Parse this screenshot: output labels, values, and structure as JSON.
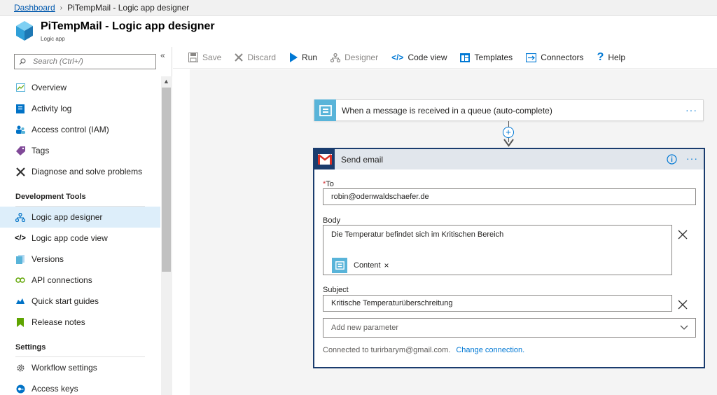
{
  "breadcrumb": {
    "home": "Dashboard",
    "separator": "›",
    "current": "PiTempMail - Logic app designer"
  },
  "header": {
    "title": "PiTempMail - Logic app designer",
    "subtitle": "Logic app"
  },
  "sidebar": {
    "search_placeholder": "Search (Ctrl+/)",
    "collapse": "«",
    "items": [
      {
        "label": "Overview",
        "icon": "overview-icon"
      },
      {
        "label": "Activity log",
        "icon": "activity-log-icon"
      },
      {
        "label": "Access control (IAM)",
        "icon": "iam-icon"
      },
      {
        "label": "Tags",
        "icon": "tag-icon"
      },
      {
        "label": "Diagnose and solve problems",
        "icon": "wrench-icon"
      }
    ],
    "dev_section": "Development Tools",
    "dev_items": [
      {
        "label": "Logic app designer",
        "icon": "designer-icon",
        "active": true
      },
      {
        "label": "Logic app code view",
        "icon": "code-icon"
      },
      {
        "label": "Versions",
        "icon": "versions-icon"
      },
      {
        "label": "API connections",
        "icon": "api-connections-icon"
      },
      {
        "label": "Quick start guides",
        "icon": "quickstart-icon"
      },
      {
        "label": "Release notes",
        "icon": "release-notes-icon"
      }
    ],
    "settings_section": "Settings",
    "settings_items": [
      {
        "label": "Workflow settings",
        "icon": "gear-icon"
      },
      {
        "label": "Access keys",
        "icon": "key-icon"
      }
    ]
  },
  "toolbar": {
    "save": "Save",
    "discard": "Discard",
    "run": "Run",
    "designer": "Designer",
    "code_view": "Code view",
    "templates": "Templates",
    "connectors": "Connectors",
    "help": "Help"
  },
  "trigger": {
    "title": "When a message is received in a queue (auto-complete)",
    "more": "···"
  },
  "action": {
    "title": "Send email",
    "more": "···",
    "to_label_req": "*",
    "to_label": "To",
    "to_value": "robin@odenwaldschaefer.de",
    "body_label": "Body",
    "body_text": "Die Temperatur befindet sich im Kritischen Bereich",
    "token_label": "Content",
    "token_remove": "×",
    "subject_label": "Subject",
    "subject_value": "Kritische Temperaturüberschreitung",
    "add_param": "Add new parameter",
    "connected_text": "Connected to turirbarym@gmail.com.",
    "change_connection": "Change connection."
  },
  "colors": {
    "accent": "#0078d4",
    "card_border": "#1a3c6e",
    "trigger_icon": "#59b4d9"
  }
}
